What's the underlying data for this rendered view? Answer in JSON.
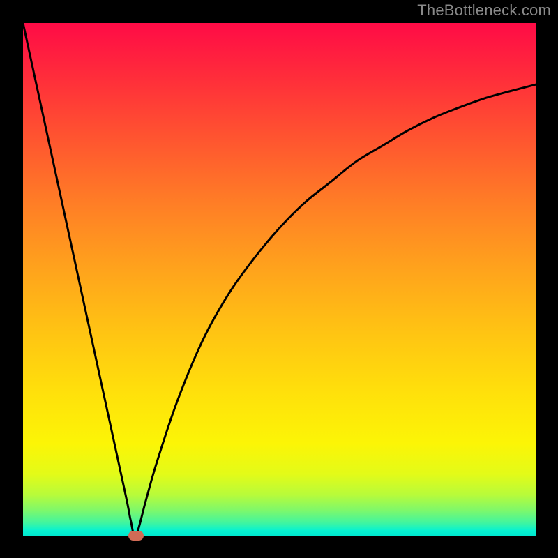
{
  "watermark": "TheBottleneck.com",
  "chart_data": {
    "type": "line",
    "title": "",
    "xlabel": "",
    "ylabel": "",
    "xlim": [
      0,
      100
    ],
    "ylim": [
      0,
      100
    ],
    "series": [
      {
        "name": "bottleneck-curve",
        "x": [
          0,
          5,
          10,
          15,
          20,
          21,
          22,
          24,
          26,
          30,
          35,
          40,
          45,
          50,
          55,
          60,
          65,
          70,
          75,
          80,
          85,
          90,
          95,
          100
        ],
        "values": [
          100,
          77,
          54,
          31,
          8,
          3,
          0,
          7,
          14,
          26,
          38,
          47,
          54,
          60,
          65,
          69,
          73,
          76,
          79,
          81.5,
          83.5,
          85.3,
          86.7,
          88
        ]
      }
    ],
    "marker": {
      "x": 22,
      "y": 0
    },
    "gradient_stops": [
      {
        "pct": 0,
        "color": "#ff0b46"
      },
      {
        "pct": 50,
        "color": "#ffc313"
      },
      {
        "pct": 100,
        "color": "#00e8d0"
      }
    ]
  }
}
